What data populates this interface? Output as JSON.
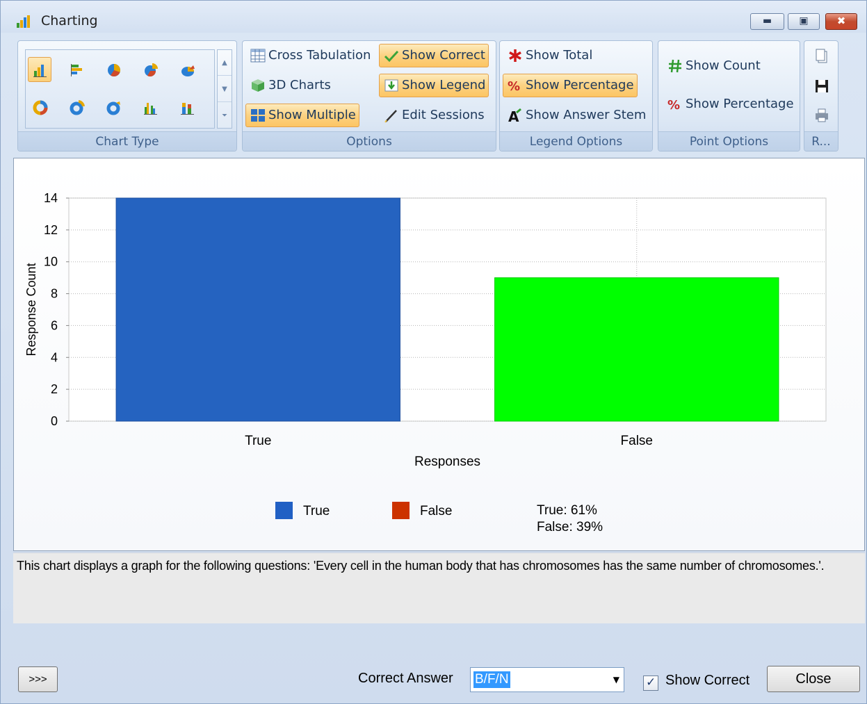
{
  "window": {
    "title": "Charting"
  },
  "ribbon": {
    "groups": {
      "chart_type": "Chart Type",
      "options": "Options",
      "legend_options": "Legend Options",
      "point_options": "Point Options",
      "report": "R..."
    },
    "options": {
      "cross_tabulation": "Cross Tabulation",
      "three_d_charts": "3D Charts",
      "show_multiple": "Show Multiple",
      "show_correct": "Show Correct",
      "show_legend": "Show Legend",
      "edit_sessions": "Edit Sessions"
    },
    "legend_options": {
      "show_total": "Show Total",
      "show_percentage": "Show Percentage",
      "show_answer_stem": "Show Answer Stem"
    },
    "point_options": {
      "show_count": "Show Count",
      "show_percentage": "Show Percentage"
    },
    "chart_type_icons": [
      "bar-chart-icon",
      "horizontal-bar-icon",
      "pie-icon",
      "exploded-pie-icon",
      "pie-3d-icon",
      "doughnut-icon",
      "exploded-doughnut-icon",
      "doughnut-3d-icon",
      "clustered-bar-icon",
      "stacked-bar-icon"
    ],
    "colors": {
      "active_fill": "#fbd282",
      "active_border": "#e3a14b"
    }
  },
  "chart_data": {
    "type": "bar",
    "categories": [
      "True",
      "False"
    ],
    "values": [
      14,
      9
    ],
    "colors": [
      "#2563c0",
      "#00ff00"
    ],
    "xlabel": "Responses",
    "ylabel": "Response Count",
    "ylim": [
      0,
      14
    ],
    "yticks": [
      "0",
      "2",
      "4",
      "6",
      "8",
      "10",
      "12",
      "14"
    ],
    "grid": true,
    "legend": {
      "position": "bottom",
      "entries": [
        {
          "name": "True",
          "color": "#2160c4"
        },
        {
          "name": "False",
          "color": "#cc3300"
        }
      ],
      "totals": [
        "True: 61%",
        "False: 39%"
      ]
    }
  },
  "description": "This chart displays a graph for the following questions: 'Every cell in the human body that has chromosomes has the same number of chromosomes.'.",
  "footer": {
    "expand_label": ">>>",
    "correct_answer_label": "Correct Answer",
    "correct_answer_value": "B/F/N",
    "show_correct_label": "Show Correct",
    "show_correct_checked": true,
    "close_label": "Close"
  }
}
